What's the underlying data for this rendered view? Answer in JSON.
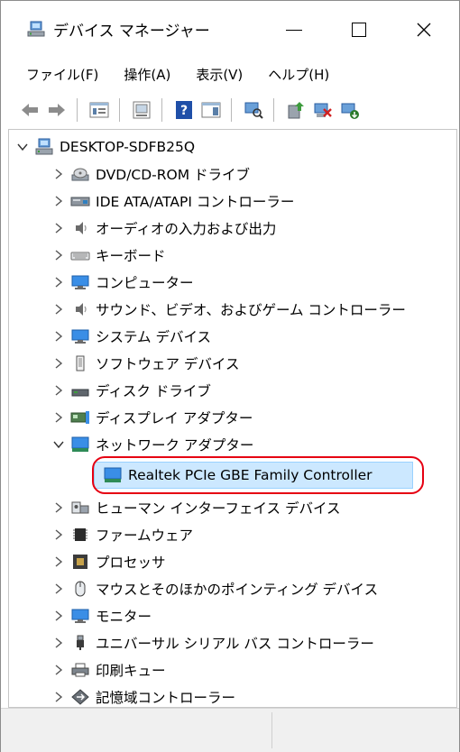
{
  "window": {
    "title": "デバイス マネージャー",
    "controls": {
      "minimize": "—",
      "maximize": "☐",
      "close": "✕"
    }
  },
  "menu": [
    "ファイル(F)",
    "操作(A)",
    "表示(V)",
    "ヘルプ(H)"
  ],
  "toolbar": [
    {
      "icon": "back-arrow-icon"
    },
    {
      "icon": "forward-arrow-icon"
    },
    {
      "icon": "properties-icon"
    },
    {
      "icon": "show-hide-tree-icon"
    },
    {
      "icon": "help-icon"
    },
    {
      "icon": "action-pane-icon"
    },
    {
      "icon": "scan-hardware-icon"
    },
    {
      "icon": "update-driver-icon"
    },
    {
      "icon": "disable-device-icon"
    },
    {
      "icon": "uninstall-device-icon"
    }
  ],
  "tree": {
    "root": {
      "label": "DESKTOP-SDFB25Q",
      "expanded": true
    },
    "categories": [
      {
        "label": "DVD/CD-ROM ドライブ",
        "icon": "dvd-drive-icon",
        "expanded": false
      },
      {
        "label": "IDE ATA/ATAPI コントローラー",
        "icon": "ide-controller-icon",
        "expanded": false
      },
      {
        "label": "オーディオの入力および出力",
        "icon": "speaker-icon",
        "expanded": false
      },
      {
        "label": "キーボード",
        "icon": "keyboard-icon",
        "expanded": false
      },
      {
        "label": "コンピューター",
        "icon": "monitor-icon",
        "expanded": false
      },
      {
        "label": "サウンド、ビデオ、およびゲーム コントローラー",
        "icon": "speaker-icon",
        "expanded": false
      },
      {
        "label": "システム デバイス",
        "icon": "monitor-icon",
        "expanded": false
      },
      {
        "label": "ソフトウェア デバイス",
        "icon": "software-device-icon",
        "expanded": false
      },
      {
        "label": "ディスク ドライブ",
        "icon": "disk-drive-icon",
        "expanded": false
      },
      {
        "label": "ディスプレイ アダプター",
        "icon": "display-adapter-icon",
        "expanded": false
      },
      {
        "label": "ネットワーク アダプター",
        "icon": "network-adapter-icon",
        "expanded": true,
        "children": [
          {
            "label": "Realtek PCIe GBE Family Controller",
            "icon": "network-adapter-icon",
            "selected": true
          }
        ]
      },
      {
        "label": "ヒューマン インターフェイス デバイス",
        "icon": "hid-icon",
        "expanded": false
      },
      {
        "label": "ファームウェア",
        "icon": "firmware-chip-icon",
        "expanded": false
      },
      {
        "label": "プロセッサ",
        "icon": "processor-icon",
        "expanded": false
      },
      {
        "label": "マウスとそのほかのポインティング デバイス",
        "icon": "mouse-icon",
        "expanded": false
      },
      {
        "label": "モニター",
        "icon": "monitor-icon",
        "expanded": false
      },
      {
        "label": "ユニバーサル シリアル バス コントローラー",
        "icon": "usb-icon",
        "expanded": false
      },
      {
        "label": "印刷キュー",
        "icon": "printer-icon",
        "expanded": false
      },
      {
        "label": "記憶域コントローラー",
        "icon": "storage-controller-icon",
        "expanded": false
      }
    ]
  },
  "colors": {
    "selection_fill": "#cce8ff",
    "selection_border": "#99d1ff",
    "annotation_ring": "#e60012"
  }
}
